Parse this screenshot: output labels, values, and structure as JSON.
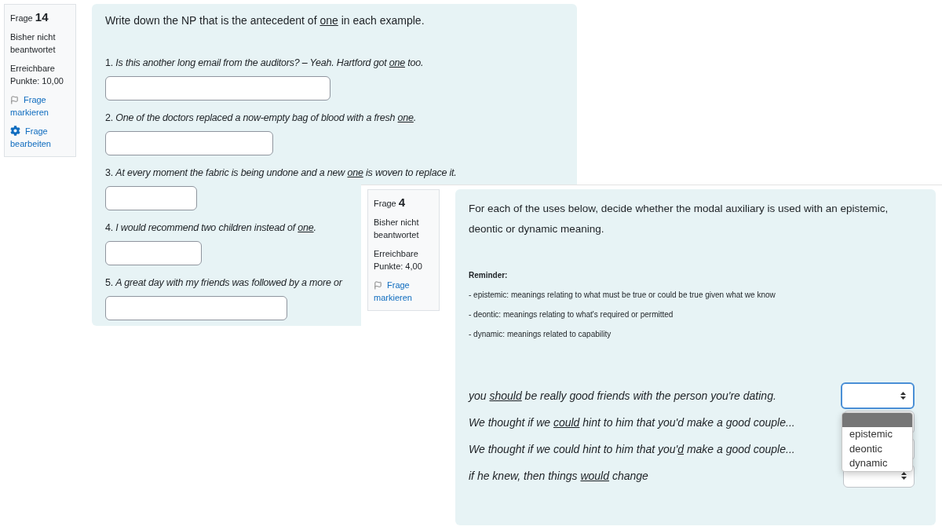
{
  "screens": [
    {
      "info": {
        "label": "Frage",
        "number": "14",
        "status": "Bisher nicht beantwortet",
        "points": "Erreichbare Punkte: 10,00",
        "links": [
          {
            "kind": "flag",
            "text": "Frage markieren"
          },
          {
            "kind": "edit",
            "text": "Frage bearbeiten"
          }
        ]
      },
      "question": {
        "kind": "text",
        "intro": {
          "before": "Write down the NP that is the antecedent of ",
          "key": "one",
          "after": " in each example."
        },
        "items": [
          {
            "number": "1.",
            "before": "Is this another long email from the auditors? – Yeah. Hartford got ",
            "key": "one",
            "after": " too."
          },
          {
            "number": "2.",
            "before": "One of the doctors replaced a now-empty bag of blood with a fresh ",
            "key": "one",
            "after": "."
          },
          {
            "number": "3.",
            "before": "At every moment the fabric is being undone and a new ",
            "key": "one",
            "after": " is woven to replace it."
          },
          {
            "number": "4.",
            "before": "I would recommend two children instead of ",
            "key": "one",
            "after": "."
          },
          {
            "number": "5.",
            "before": "A great day with my friends was followed by a more or"
          }
        ]
      }
    },
    {
      "info": {
        "label": "Frage",
        "number": "4",
        "status": "Bisher nicht beantwortet",
        "points": "Erreichbare Punkte: 4,00",
        "links": [
          {
            "kind": "flag",
            "text": "Frage markieren"
          }
        ]
      },
      "question": {
        "kind": "select",
        "intro": "For each of the uses below, decide whether the modal auxiliary is used with an epistemic, deontic or dynamic meaning.",
        "reminder_title": "Reminder:",
        "reminders": [
          "- epistemic: meanings relating to what must be true or could be true given what we know",
          "- deontic: meanings relating to what's required or permitted",
          "- dynamic: meanings related to capability"
        ],
        "items": [
          {
            "before": "you ",
            "key": "should",
            "after": " be really good friends with the person you're dating.",
            "focused": true
          },
          {
            "before": "We thought if we ",
            "key": "could",
            "after": " hint to him that you'd make a good couple...",
            "focused": false
          },
          {
            "before": "We thought if we could hint to him that you'",
            "key": "d",
            "after": " make a good couple...",
            "focused": false
          },
          {
            "before": "if he knew, then things ",
            "key": "would",
            "after": " change",
            "focused": false
          }
        ],
        "dropdown": {
          "open": true,
          "blank_highlighted": true,
          "options": [
            "epistemic",
            "deontic",
            "dynamic"
          ]
        }
      }
    }
  ]
}
